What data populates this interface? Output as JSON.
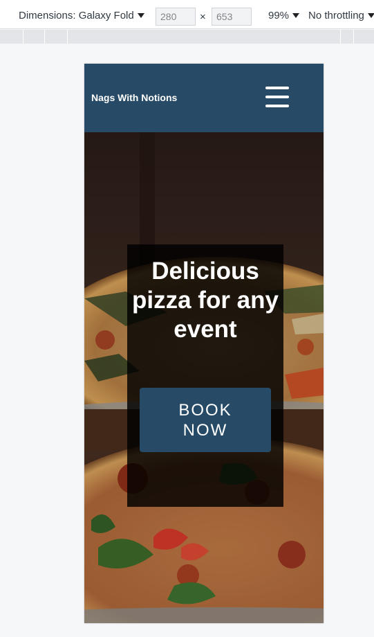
{
  "devtools": {
    "dimensions_label": "Dimensions: Galaxy Fold",
    "width_value": "280",
    "times_sign": "×",
    "height_value": "653",
    "zoom": "99%",
    "throttling": "No throttling"
  },
  "site": {
    "brand": "Nags With Notions",
    "menu_icon": "hamburger-icon",
    "hero": {
      "title": "Delicious pizza for any event",
      "cta_label": "BOOK NOW"
    },
    "colors": {
      "navbar": "#274b66",
      "button": "#274b66",
      "overlay": "#000000"
    }
  }
}
